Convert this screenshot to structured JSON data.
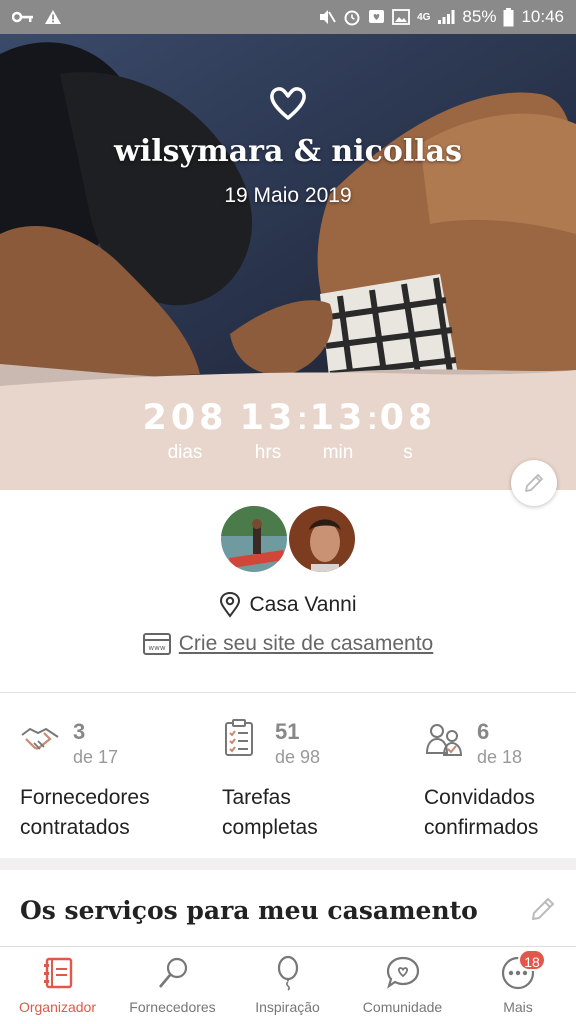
{
  "status_bar": {
    "battery": "85%",
    "time": "10:46",
    "network": "4G"
  },
  "hero": {
    "couple_names": "wilsymara & nicollas",
    "date": "19 Maio 2019",
    "icon": "heart-icon"
  },
  "countdown": {
    "days": "208",
    "hours": "13",
    "minutes": "13",
    "seconds": "08",
    "days_label": "dias",
    "hours_label": "hrs",
    "minutes_label": "min",
    "seconds_label": "s",
    "separator": ":"
  },
  "profile": {
    "venue": "Casa Vanni",
    "site_link": "Crie seu site de casamento"
  },
  "stats": [
    {
      "count": "3",
      "total": "de 17",
      "label_line1": "Fornecedores",
      "label_line2": "contratados",
      "icon": "handshake-icon"
    },
    {
      "count": "51",
      "total": "de 98",
      "label_line1": "Tarefas",
      "label_line2": "completas",
      "icon": "checklist-icon"
    },
    {
      "count": "6",
      "total": "de 18",
      "label_line1": "Convidados",
      "label_line2": "confirmados",
      "icon": "guests-icon"
    }
  ],
  "services": {
    "title": "Os serviços para meu casamento"
  },
  "bottom_nav": [
    {
      "label": "Organizador",
      "icon": "planner-icon",
      "active": true
    },
    {
      "label": "Fornecedores",
      "icon": "magnifier-icon",
      "active": false
    },
    {
      "label": "Inspiração",
      "icon": "balloon-icon",
      "active": false
    },
    {
      "label": "Comunidade",
      "icon": "chat-heart-icon",
      "active": false
    },
    {
      "label": "Mais",
      "icon": "more-icon",
      "active": false,
      "badge": "18"
    }
  ],
  "colors": {
    "accent": "#e2574c",
    "countdown_band": "#e8d6cc",
    "status_bar": "#8a8a8a"
  }
}
